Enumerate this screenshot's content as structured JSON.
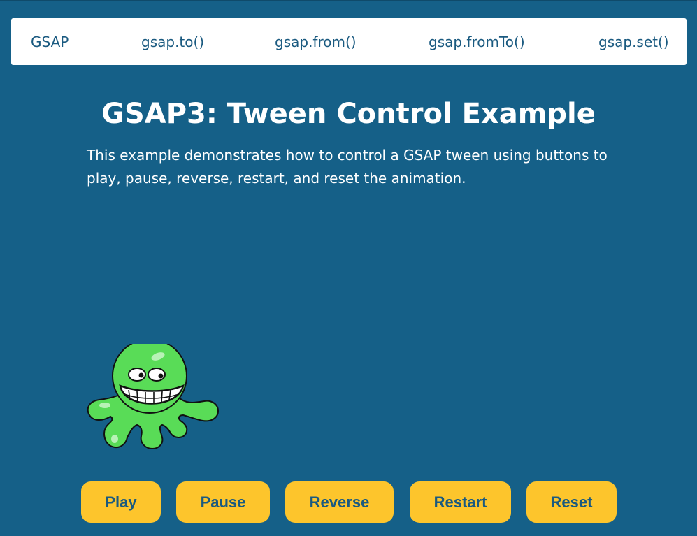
{
  "nav": {
    "brand": "GSAP",
    "links": [
      "gsap.to()",
      "gsap.from()",
      "gsap.fromTo()",
      "gsap.set()"
    ]
  },
  "main": {
    "title": "GSAP3: Tween Control Example",
    "description": "This example demonstrates how to control a GSAP tween using buttons to play, pause, reverse, restart, and reset the animation."
  },
  "controls": {
    "play": "Play",
    "pause": "Pause",
    "reverse": "Reverse",
    "restart": "Restart",
    "reset": "Reset"
  },
  "colors": {
    "background": "#156088",
    "nav_bg": "#ffffff",
    "nav_text": "#1a5a80",
    "button_bg": "#fdc52c",
    "mascot_green": "#59dc57"
  },
  "mascot": {
    "icon": "green-octopus-icon"
  }
}
